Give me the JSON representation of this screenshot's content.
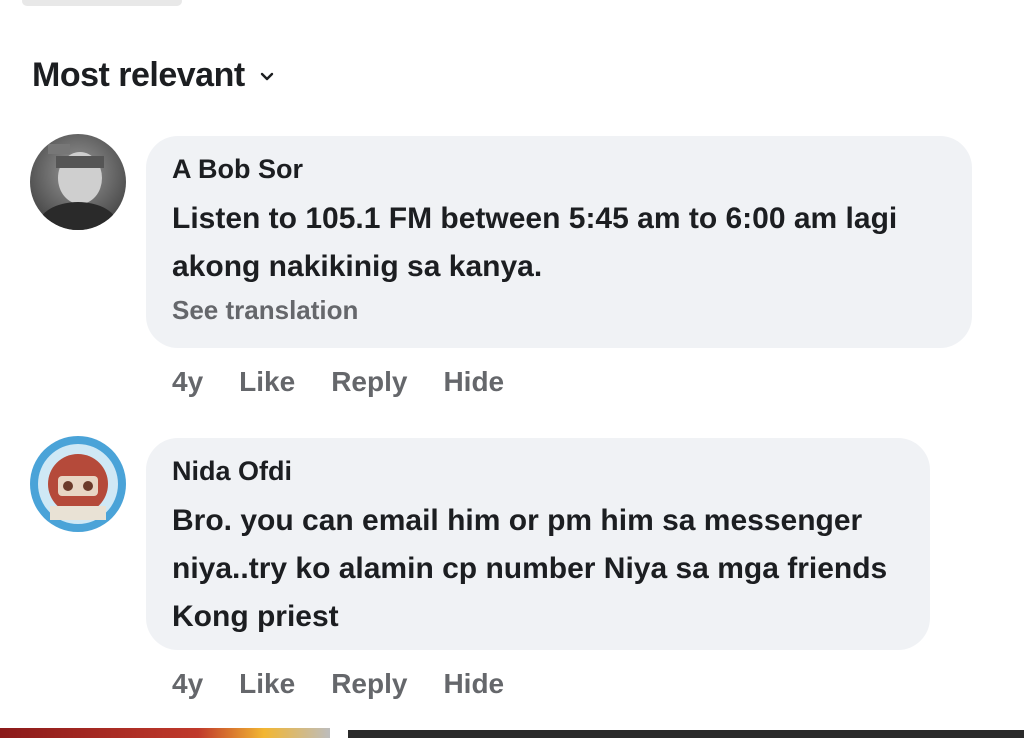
{
  "sort": {
    "label": "Most relevant"
  },
  "comments": [
    {
      "author": "A Bob Sor",
      "text": "Listen to 105.1 FM between 5:45 am to 6:00 am  lagi akong nakikinig sa kanya.",
      "see_translation": "See translation",
      "time": "4y",
      "like": "Like",
      "reply": "Reply",
      "hide": "Hide"
    },
    {
      "author": "Nida Ofdi",
      "text": "Bro. you can email him or pm him sa messenger niya..try ko alamin cp number Niya sa mga friends Kong priest",
      "time": "4y",
      "like": "Like",
      "reply": "Reply",
      "hide": "Hide"
    }
  ],
  "colors": {
    "bubble": "#f0f2f5",
    "secondary_text": "#65676b",
    "primary_text": "#1c1e21"
  }
}
